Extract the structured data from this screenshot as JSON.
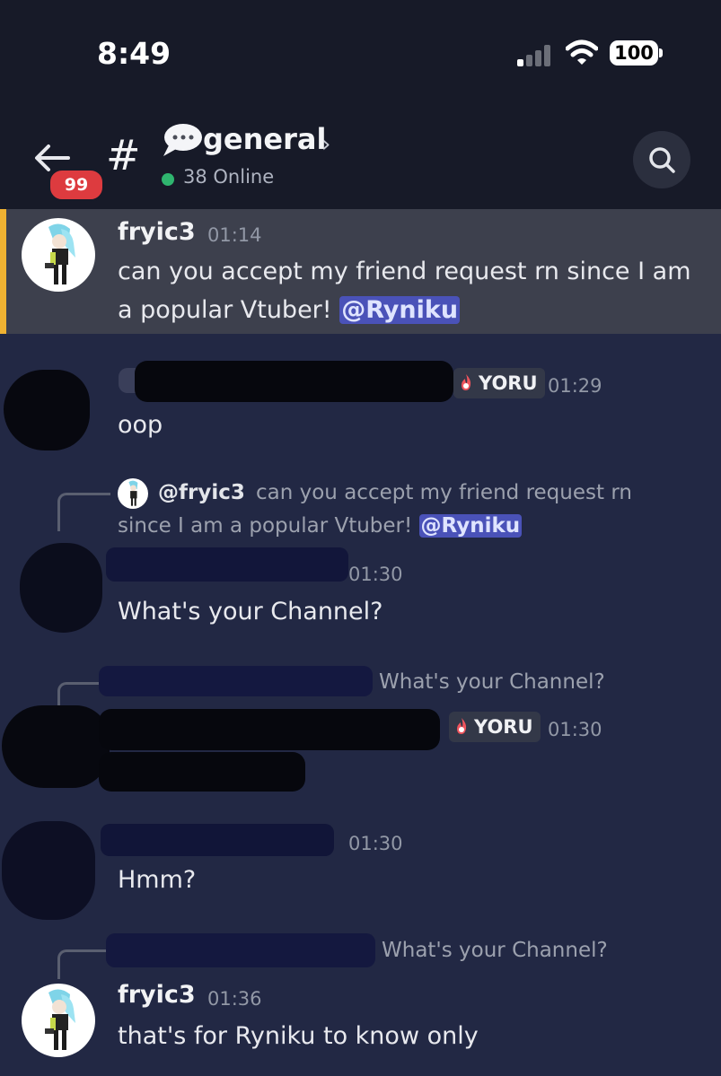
{
  "status_bar": {
    "time": "8:49",
    "battery": "100"
  },
  "header": {
    "unread_count": "99",
    "channel_name": "general",
    "online_text": "38 Online"
  },
  "messages": [
    {
      "author": "fryic3",
      "time": "01:14",
      "text": "can you accept my friend request rn since I am",
      "text_line2": "a popular Vtuber! ",
      "mention": "@Ryniku",
      "highlighted": true
    },
    {
      "author_redacted": true,
      "role": "YORU",
      "time": "01:29",
      "text": "oop"
    },
    {
      "reply_to": {
        "author": "@fryic3",
        "text": "can you accept my friend request rn",
        "text_line2": "since I am a popular Vtuber! ",
        "mention": "@Ryniku"
      },
      "author_redacted": true,
      "time": "01:30",
      "text": "What's your Channel?"
    },
    {
      "reply_to": {
        "text": "What's your Channel?"
      },
      "author_redacted": true,
      "role": "YORU",
      "time": "01:30",
      "text_redacted": true
    },
    {
      "author_redacted": true,
      "time": "01:30",
      "text": "Hmm?"
    },
    {
      "reply_to": {
        "text": "What's your Channel?"
      },
      "author": "fryic3",
      "time": "01:36",
      "text": "that's for Ryniku to know only"
    }
  ],
  "colors": {
    "header_bg": "#171a28",
    "chat_bg": "#222844",
    "highlight_bg": "#3d404d",
    "highlight_bar": "#f0b232",
    "mention_bg": "#4a52b8",
    "badge_red": "#dd3b3f",
    "online_green": "#2fb56f"
  },
  "icons": [
    "back-arrow-icon",
    "hash-icon",
    "speech-bubble-icon",
    "chevron-right-icon",
    "search-icon",
    "flame-icon",
    "signal-icon",
    "wifi-icon",
    "battery-icon"
  ]
}
